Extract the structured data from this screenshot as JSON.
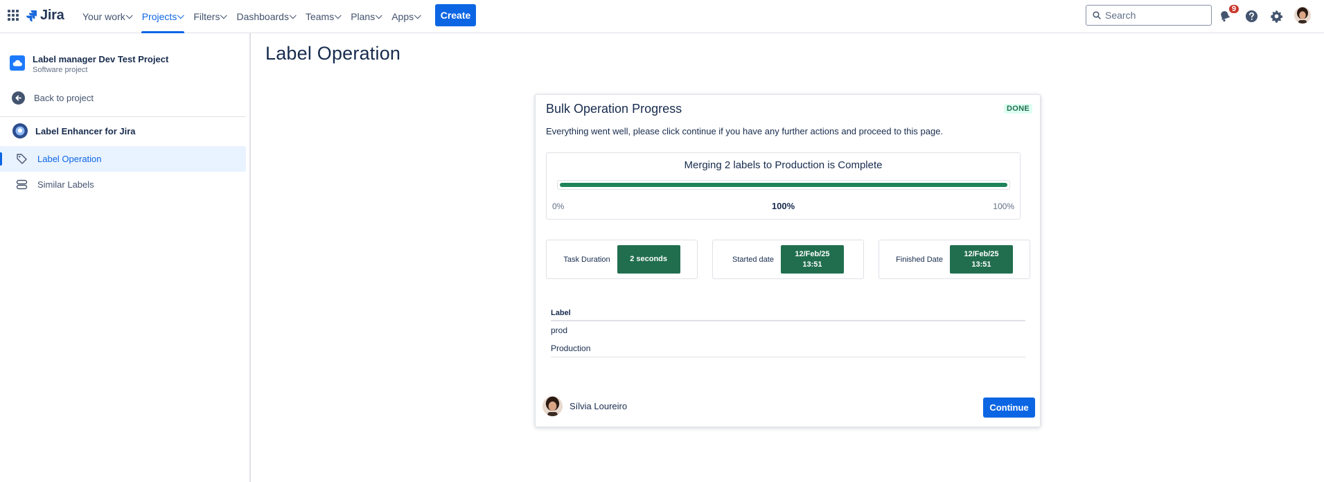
{
  "topnav": {
    "logo_text": "Jira",
    "items": [
      {
        "label": "Your work"
      },
      {
        "label": "Projects"
      },
      {
        "label": "Filters"
      },
      {
        "label": "Dashboards"
      },
      {
        "label": "Teams"
      },
      {
        "label": "Plans"
      },
      {
        "label": "Apps"
      }
    ],
    "active_item": "Projects",
    "create_label": "Create",
    "search_placeholder": "Search",
    "notification_count": "9",
    "accent_color": "#0C66E4"
  },
  "sidebar": {
    "project_name": "Label manager Dev Test Project",
    "project_type": "Software project",
    "back_label": "Back to project",
    "app_name": "Label Enhancer for Jira",
    "items": [
      {
        "label": "Label Operation",
        "icon": "label-tag-icon",
        "active": true
      },
      {
        "label": "Similar Labels",
        "icon": "stack-icon",
        "active": false
      }
    ]
  },
  "main": {
    "page_title": "Label Operation",
    "card": {
      "title": "Bulk Operation Progress",
      "status": "DONE",
      "description": "Everything went well, please click continue if you have any further actions and proceed to this page.",
      "progress": {
        "title": "Merging 2 labels to Production is Complete",
        "min_label": "0%",
        "value_label": "100%",
        "max_label": "100%",
        "value": 1.0,
        "color": "#1F845A"
      },
      "stats": [
        {
          "label": "Task Duration",
          "value": "2 seconds"
        },
        {
          "label": "Started date",
          "value": "12/Feb/25\n13:51"
        },
        {
          "label": "Finished Date",
          "value": "12/Feb/25\n13:51"
        }
      ],
      "table": {
        "header": "Label",
        "rows": [
          "prod",
          "Production"
        ]
      },
      "user_name": "Sílvia Loureiro",
      "continue_label": "Continue"
    }
  }
}
